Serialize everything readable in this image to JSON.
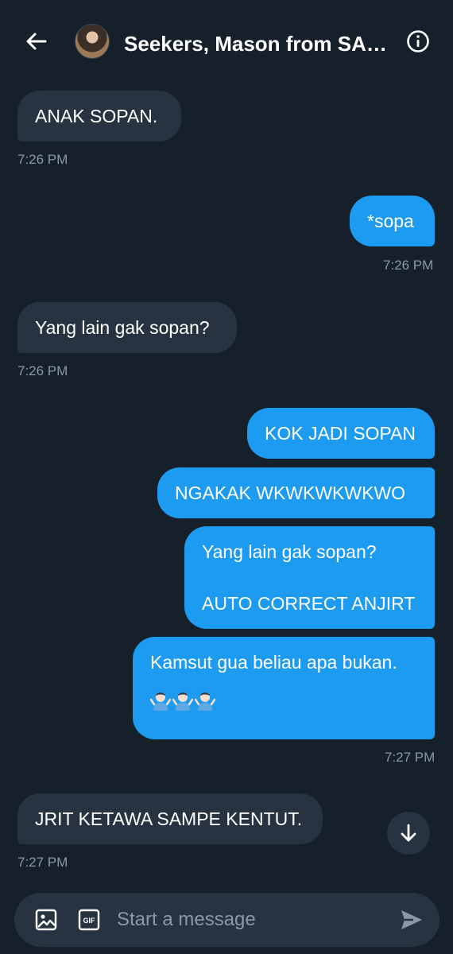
{
  "header": {
    "title": "Seekers, Mason from SAPA...",
    "back_icon": "arrow-left-icon",
    "info_icon": "info-circle-icon"
  },
  "messages": [
    {
      "dir": "in",
      "text": "ANAK SOPAN.",
      "time": "7:26 PM"
    },
    {
      "dir": "out",
      "text": "*sopa",
      "time": "7:26 PM"
    },
    {
      "dir": "in",
      "text": "Yang lain gak sopan?",
      "time": "7:26 PM"
    },
    {
      "dir": "out",
      "text": "KOK JADI SOPAN"
    },
    {
      "dir": "out",
      "text": "NGAKAK WKWKWKWKWO"
    },
    {
      "dir": "out",
      "line1": "Yang lain gak sopan?",
      "line2": "AUTO CORRECT ANJIRT"
    },
    {
      "dir": "out",
      "text": "Kamsut gua beliau apa bukan.",
      "emoji": "🤷🏻‍♂️🤷🏻‍♂️🤷🏻‍♂️",
      "time": "7:27 PM"
    },
    {
      "dir": "in",
      "text": "JRIT KETAWA SAMPE KENTUT.",
      "time": "7:27 PM"
    }
  ],
  "composer": {
    "placeholder": "Start a message",
    "gif_label": "GIF",
    "icons": [
      "image-icon",
      "gif-icon",
      "send-icon"
    ]
  },
  "colors": {
    "background": "#15202b",
    "incoming_bubble": "#273340",
    "outgoing_bubble": "#1d9bf0",
    "timestamp": "#8b98a5"
  }
}
